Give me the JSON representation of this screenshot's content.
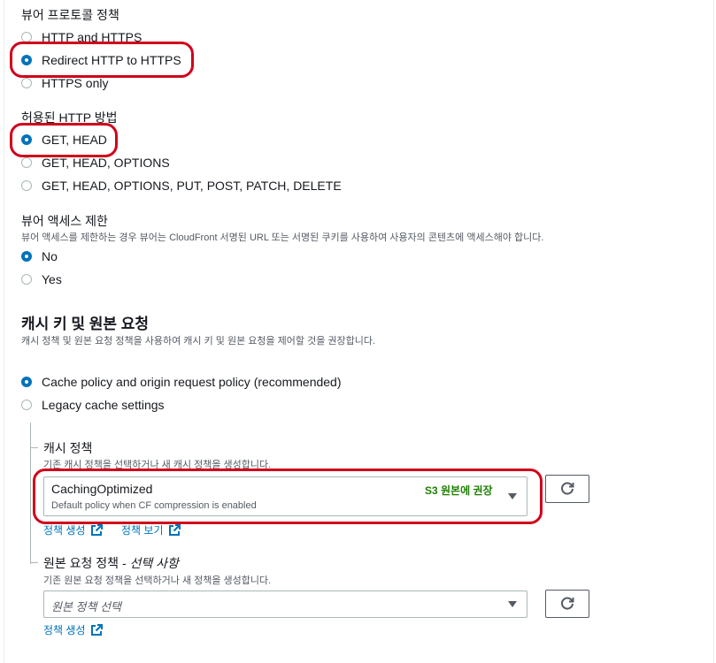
{
  "viewer_protocol": {
    "title": "뷰어 프로토콜 정책",
    "options": [
      "HTTP and HTTPS",
      "Redirect HTTP to HTTPS",
      "HTTPS only"
    ],
    "selected": 1
  },
  "allowed_methods": {
    "title": "허용된 HTTP 방법",
    "options": [
      "GET, HEAD",
      "GET, HEAD, OPTIONS",
      "GET, HEAD, OPTIONS, PUT, POST, PATCH, DELETE"
    ],
    "selected": 0
  },
  "restrict_access": {
    "title": "뷰어 액세스 제한",
    "description": "뷰어 액세스를 제한하는 경우 뷰어는 CloudFront 서명된 URL 또는 서명된 쿠키를 사용하여 사용자의 콘텐츠에 액세스해야 합니다.",
    "options": [
      "No",
      "Yes"
    ],
    "selected": 0
  },
  "cache_section": {
    "title": "캐시 키 및 원본 요청",
    "description": "캐시 정책 및 원본 요청 정책을 사용하여 캐시 키 및 원본 요청을 제어할 것을 권장합니다.",
    "options": [
      "Cache policy and origin request policy (recommended)",
      "Legacy cache settings"
    ],
    "selected": 0
  },
  "cache_policy": {
    "title": "캐시 정책",
    "description": "기존 캐시 정책을 선택하거나 새 캐시 정책을 생성합니다.",
    "selected_value": "CachingOptimized",
    "selected_description": "Default policy when CF compression is enabled",
    "badge": "S3 원본에 권장",
    "create_link": "정책 생성",
    "view_link": "정책 보기"
  },
  "origin_request_policy": {
    "title_main": "원본 요청 정책 - ",
    "title_optional": "선택 사항",
    "description": "기존 원본 요청 정책을 선택하거나 새 정책을 생성합니다.",
    "placeholder": "원본 정책 선택",
    "create_link": "정책 생성"
  },
  "colors": {
    "accent": "#0073bb",
    "highlight": "#d0021b",
    "badge": "#1d8102"
  }
}
